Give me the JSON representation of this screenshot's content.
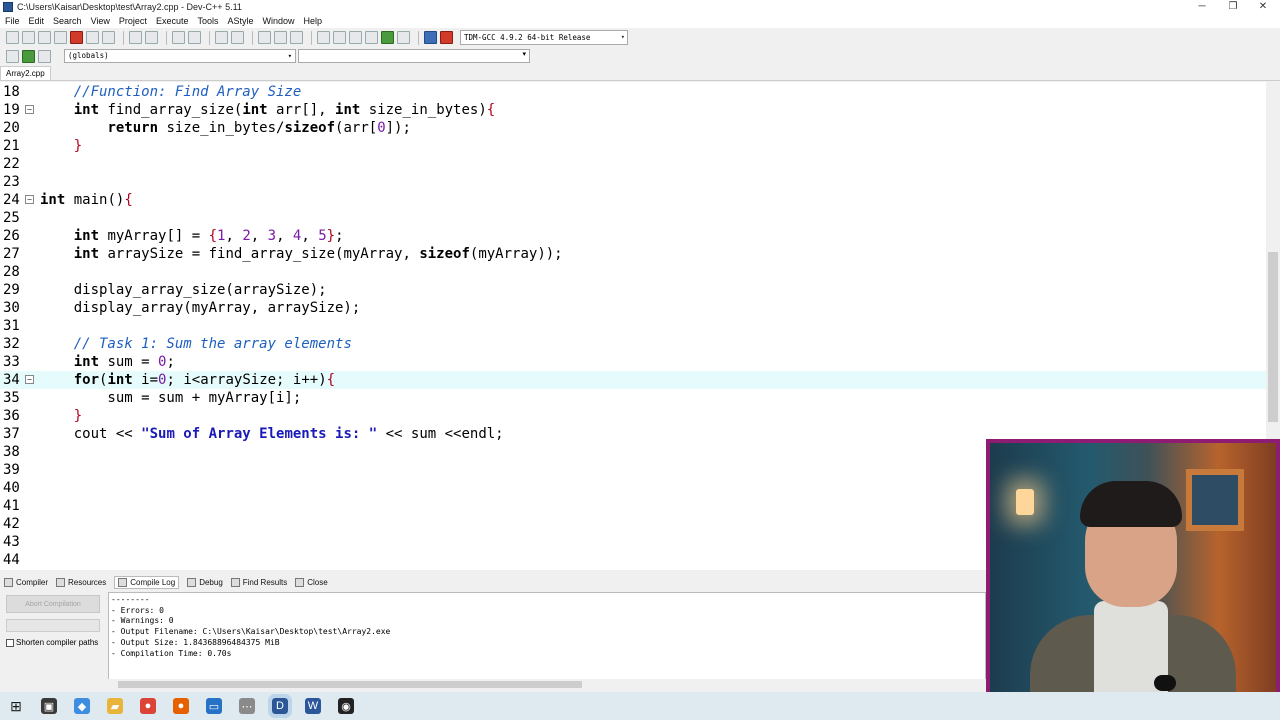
{
  "window": {
    "title": "C:\\Users\\Kaisar\\Desktop\\test\\Array2.cpp - Dev-C++ 5.11",
    "minimize": "─",
    "restore": "❐",
    "close": "✕"
  },
  "menu": [
    "File",
    "Edit",
    "Search",
    "View",
    "Project",
    "Execute",
    "Tools",
    "AStyle",
    "Window",
    "Help"
  ],
  "toolbar": {
    "compiler": "TDM-GCC 4.9.2 64-bit Release",
    "globals": "(globals)"
  },
  "file_tab": "Array2.cpp",
  "editor": {
    "highlighted_line": 34,
    "lines": [
      {
        "n": "18",
        "fold": false,
        "html": "    <span class=\"cm\">//Function: Find Array Size</span>"
      },
      {
        "n": "19",
        "fold": true,
        "html": "    <span class=\"kw\">int</span> find_array_size(<span class=\"kw\">int</span> arr[], <span class=\"kw\">int</span> size_in_bytes)<span class=\"op\">{</span>"
      },
      {
        "n": "20",
        "fold": false,
        "html": "        <span class=\"kw\">return</span> size_in_bytes/<span class=\"kw\">sizeof</span>(arr[<span class=\"num\">0</span>]);"
      },
      {
        "n": "21",
        "fold": false,
        "html": "    <span class=\"op\">}</span>"
      },
      {
        "n": "22",
        "fold": false,
        "html": ""
      },
      {
        "n": "23",
        "fold": false,
        "html": ""
      },
      {
        "n": "24",
        "fold": true,
        "html": "<span class=\"kw\">int</span> main()<span class=\"op\">{</span>"
      },
      {
        "n": "25",
        "fold": false,
        "html": ""
      },
      {
        "n": "26",
        "fold": false,
        "html": "    <span class=\"kw\">int</span> myArray[] = <span class=\"op\">{</span><span class=\"num\">1</span>, <span class=\"num\">2</span>, <span class=\"num\">3</span>, <span class=\"num\">4</span>, <span class=\"num\">5</span><span class=\"op\">}</span>;"
      },
      {
        "n": "27",
        "fold": false,
        "html": "    <span class=\"kw\">int</span> arraySize = find_array_size(myArray, <span class=\"kw\">sizeof</span>(myArray));"
      },
      {
        "n": "28",
        "fold": false,
        "html": ""
      },
      {
        "n": "29",
        "fold": false,
        "html": "    display_array_size(arraySize);"
      },
      {
        "n": "30",
        "fold": false,
        "html": "    display_array(myArray, arraySize);"
      },
      {
        "n": "31",
        "fold": false,
        "html": ""
      },
      {
        "n": "32",
        "fold": false,
        "html": "    <span class=\"cm\">// Task 1: Sum the array elements</span>"
      },
      {
        "n": "33",
        "fold": false,
        "html": "    <span class=\"kw\">int</span> sum = <span class=\"num\">0</span>;"
      },
      {
        "n": "34",
        "fold": true,
        "html": "    <span class=\"kw\">for</span>(<span class=\"kw\">int</span> i=<span class=\"num\">0</span>; i&lt;arraySize; i++)<span class=\"op\">{</span>"
      },
      {
        "n": "35",
        "fold": false,
        "html": "        sum = sum + myArray[i];"
      },
      {
        "n": "36",
        "fold": false,
        "html": "    <span class=\"op\">}</span>"
      },
      {
        "n": "37",
        "fold": false,
        "html": "    cout &lt;&lt; <span class=\"str\">\"Sum of Array Elements is: \"</span> &lt;&lt; sum &lt;&lt;endl;"
      },
      {
        "n": "38",
        "fold": false,
        "html": ""
      },
      {
        "n": "39",
        "fold": false,
        "html": ""
      },
      {
        "n": "40",
        "fold": false,
        "html": ""
      },
      {
        "n": "41",
        "fold": false,
        "html": ""
      },
      {
        "n": "42",
        "fold": false,
        "html": ""
      },
      {
        "n": "43",
        "fold": false,
        "html": ""
      },
      {
        "n": "44",
        "fold": false,
        "html": ""
      }
    ]
  },
  "bottom_tabs": [
    "Compiler",
    "Resources",
    "Compile Log",
    "Debug",
    "Find Results",
    "Close"
  ],
  "bottom_active_tab": "Compile Log",
  "abort_button": "Abort Compilation",
  "shorten_paths_label": "Shorten compiler paths",
  "compile_log": [
    "--------",
    "- Errors: 0",
    "- Warnings: 0",
    "- Output Filename: C:\\Users\\Kaisar\\Desktop\\test\\Array2.exe",
    "- Output Size: 1.84368896484375 MiB",
    "- Compilation Time: 0.70s"
  ],
  "taskbar": [
    {
      "name": "start-icon",
      "glyph": "⊞",
      "color": "#dfeaf0"
    },
    {
      "name": "task-view-icon",
      "glyph": "▣",
      "color": "#3a3a3a"
    },
    {
      "name": "photos-icon",
      "glyph": "◆",
      "color": "#3d8ee0"
    },
    {
      "name": "file-explorer-icon",
      "glyph": "▰",
      "color": "#e8b53a"
    },
    {
      "name": "chrome-icon",
      "glyph": "●",
      "color": "#db4437"
    },
    {
      "name": "firefox-icon",
      "glyph": "●",
      "color": "#e66000"
    },
    {
      "name": "remote-desktop-icon",
      "glyph": "▭",
      "color": "#2672c4"
    },
    {
      "name": "settings-icon",
      "glyph": "⋯",
      "color": "#8a8a8a"
    },
    {
      "name": "dev-cpp-icon",
      "glyph": "D",
      "color": "#2b5797"
    },
    {
      "name": "word-icon",
      "glyph": "W",
      "color": "#2b579a"
    },
    {
      "name": "obs-icon",
      "glyph": "◉",
      "color": "#222222"
    }
  ]
}
